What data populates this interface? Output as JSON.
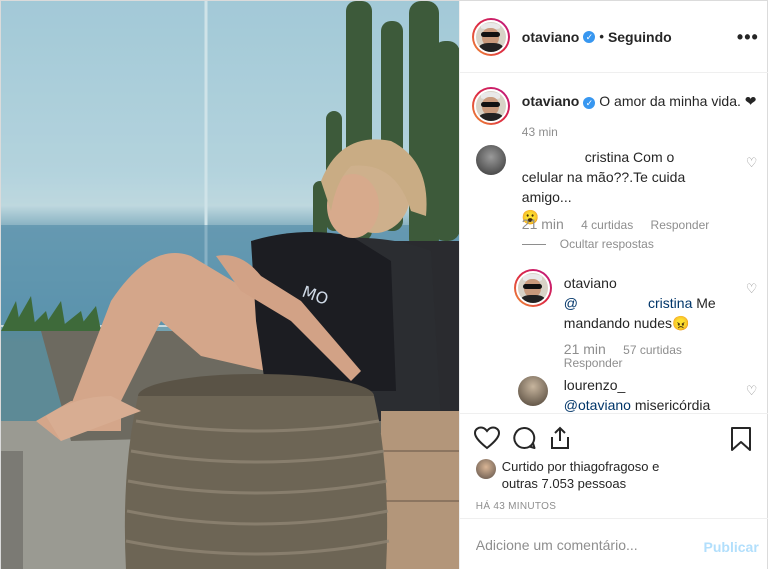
{
  "post": {
    "author": "otaviano",
    "follow_status": "Seguindo",
    "more_icon": "more-icon",
    "verified_icon": "verified-badge-icon",
    "caption": {
      "username": "otaviano",
      "text": "O amor da minha vida. ❤",
      "time": "43 min"
    },
    "comments": [
      {
        "username": "cristina",
        "text_line1": "Com o",
        "text_line2": "celular na mão??.Te cuida amigo...",
        "text_line3": "😮",
        "time": "21 min",
        "likes": "4 curtidas",
        "reply": "Responder",
        "hide_replies": "Ocultar respostas",
        "replies": [
          {
            "username": "otaviano",
            "mention": "@",
            "mention_tail": "cristina",
            "text_tail": "Me",
            "text_line2": "mandando nudes😠",
            "time": "21 min",
            "likes": "57 curtidas",
            "reply": "Responder"
          },
          {
            "username": "lourenzo_",
            "mention": "@otaviano",
            "text": "misericórdia"
          }
        ]
      }
    ],
    "actions": {
      "like_icon": "heart-icon",
      "comment_icon": "comment-icon",
      "share_icon": "share-icon",
      "save_icon": "bookmark-icon"
    },
    "liked_by": {
      "prefix": "Curtido por",
      "user": "thiagofragoso",
      "suffix": "e",
      "others": "outras 7.053 pessoas"
    },
    "timestamp": "HÁ 43 MINUTOS",
    "add_comment": {
      "placeholder": "Adicione um comentário...",
      "publish": "Publicar"
    }
  },
  "colors": {
    "link_blue": "#3897f0",
    "publish_disabled": "#b2dffc",
    "meta_gray": "#8e8e8e"
  }
}
